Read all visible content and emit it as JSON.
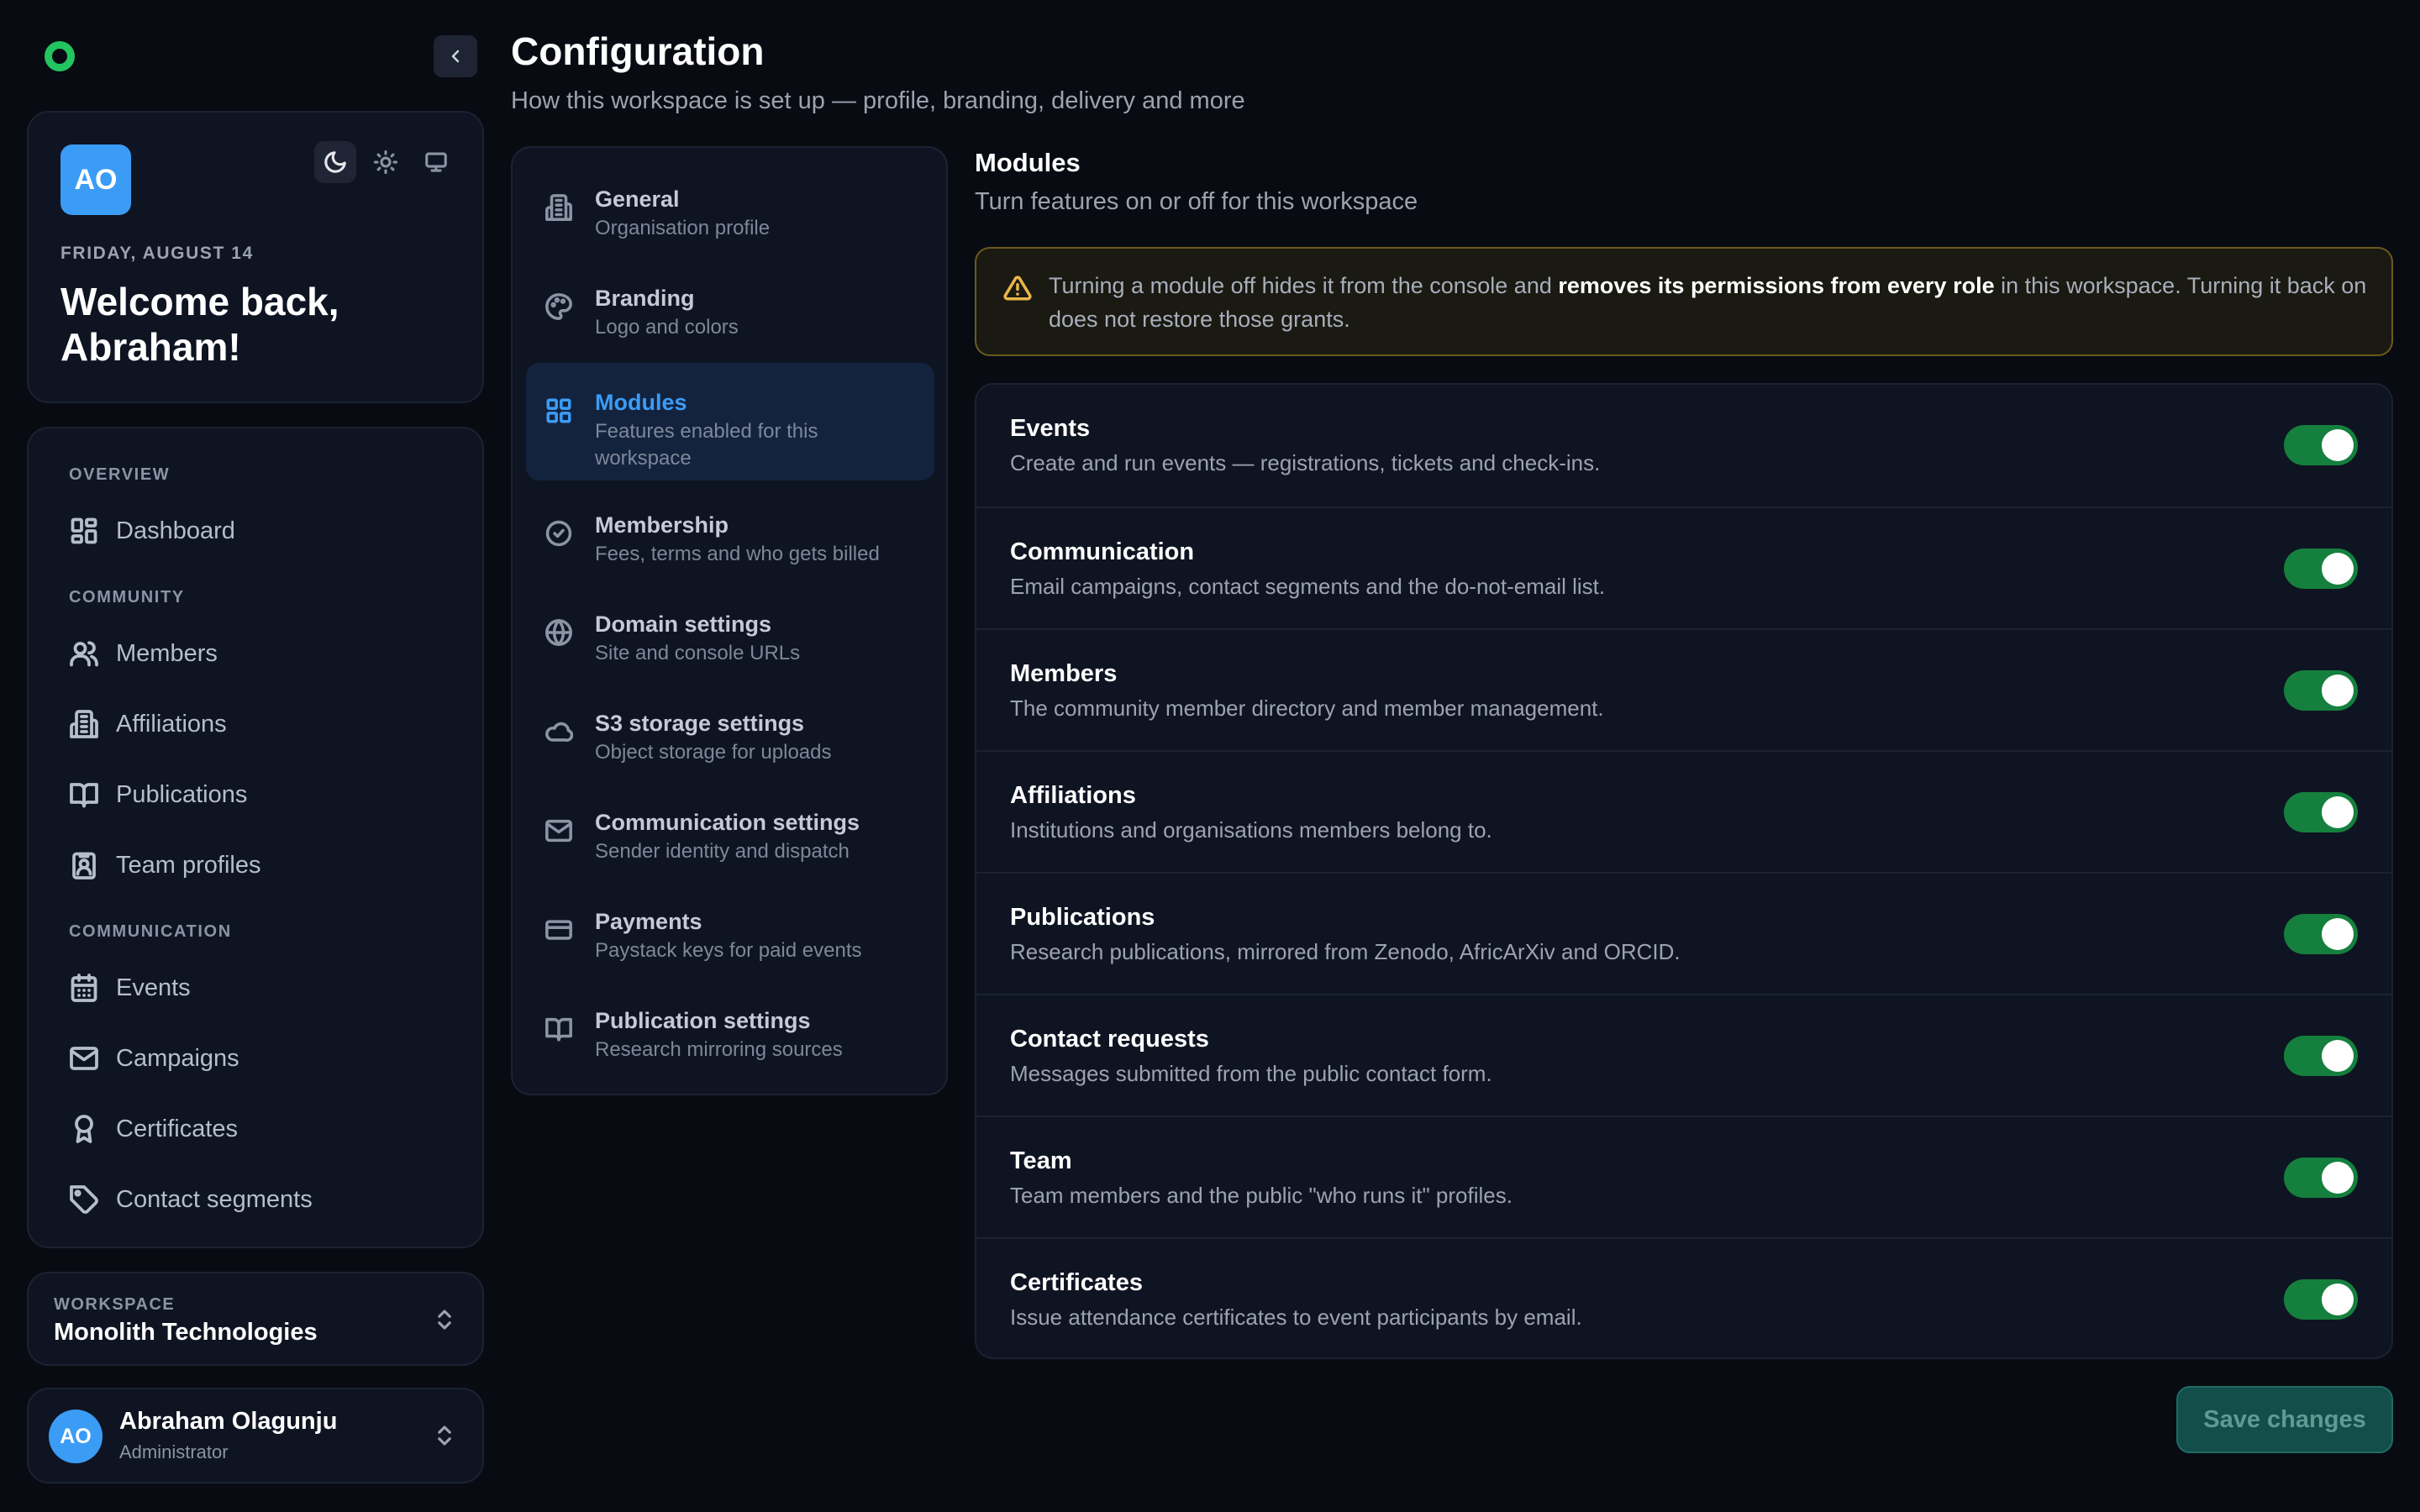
{
  "sidebar": {
    "profile": {
      "initials": "AO",
      "date": "FRIDAY, AUGUST 14",
      "welcome": "Welcome back, Abraham!",
      "theme_options": [
        "moon-icon",
        "sun-icon",
        "monitor-icon"
      ],
      "active_theme": "dark"
    },
    "nav": {
      "sections": [
        "OVERVIEW",
        "COMMUNITY",
        "COMMUNICATION"
      ],
      "items": [
        {
          "label": "Dashboard",
          "icon": "dashboard-icon",
          "section": "OVERVIEW"
        },
        {
          "label": "Members",
          "icon": "users-icon",
          "section": "COMMUNITY"
        },
        {
          "label": "Affiliations",
          "icon": "building-icon",
          "section": "COMMUNITY"
        },
        {
          "label": "Publications",
          "icon": "book-icon",
          "section": "COMMUNITY"
        },
        {
          "label": "Team profiles",
          "icon": "id-badge-icon",
          "section": "COMMUNITY"
        },
        {
          "label": "Events",
          "icon": "calendar-icon",
          "section": "COMMUNICATION"
        },
        {
          "label": "Campaigns",
          "icon": "mail-icon",
          "section": "COMMUNICATION"
        },
        {
          "label": "Certificates",
          "icon": "award-icon",
          "section": "COMMUNICATION"
        },
        {
          "label": "Contact segments",
          "icon": "tag-icon",
          "section": "COMMUNICATION"
        }
      ]
    },
    "workspace": {
      "label": "WORKSPACE",
      "name": "Monolith Technologies"
    },
    "user": {
      "initials": "AO",
      "name": "Abraham Olagunju",
      "role": "Administrator"
    }
  },
  "header": {
    "title": "Configuration",
    "subtitle": "How this workspace is set up — profile, branding, delivery and more"
  },
  "settings_menu": [
    {
      "title": "General",
      "desc": "Organisation profile",
      "icon": "building-icon"
    },
    {
      "title": "Branding",
      "desc": "Logo and colors",
      "icon": "palette-icon"
    },
    {
      "title": "Modules",
      "desc": "Features enabled for this workspace",
      "icon": "grid-icon",
      "active": true
    },
    {
      "title": "Membership",
      "desc": "Fees, terms and who gets billed",
      "icon": "badge-check-icon"
    },
    {
      "title": "Domain settings",
      "desc": "Site and console URLs",
      "icon": "globe-icon"
    },
    {
      "title": "S3 storage settings",
      "desc": "Object storage for uploads",
      "icon": "cloud-icon"
    },
    {
      "title": "Communication settings",
      "desc": "Sender identity and dispatch",
      "icon": "mail-icon"
    },
    {
      "title": "Payments",
      "desc": "Paystack keys for paid events",
      "icon": "credit-card-icon"
    },
    {
      "title": "Publication settings",
      "desc": "Research mirroring sources",
      "icon": "book-icon"
    }
  ],
  "modules": {
    "title": "Modules",
    "subtitle": "Turn features on or off for this workspace",
    "warning": {
      "pre": "Turning a module off hides it from the console and ",
      "bold": "removes its permissions from every role",
      "post": " in this workspace. Turning it back on does not restore those grants."
    },
    "items": [
      {
        "name": "Events",
        "desc": "Create and run events — registrations, tickets and check-ins.",
        "enabled": true
      },
      {
        "name": "Communication",
        "desc": "Email campaigns, contact segments and the do-not-email list.",
        "enabled": true
      },
      {
        "name": "Members",
        "desc": "The community member directory and member management.",
        "enabled": true
      },
      {
        "name": "Affiliations",
        "desc": "Institutions and organisations members belong to.",
        "enabled": true
      },
      {
        "name": "Publications",
        "desc": "Research publications, mirrored from Zenodo, AfricArXiv and ORCID.",
        "enabled": true
      },
      {
        "name": "Contact requests",
        "desc": "Messages submitted from the public contact form.",
        "enabled": true
      },
      {
        "name": "Team",
        "desc": "Team members and the public \"who runs it\" profiles.",
        "enabled": true
      },
      {
        "name": "Certificates",
        "desc": "Issue attendance certificates to event participants by email.",
        "enabled": true
      }
    ],
    "save_label": "Save changes"
  },
  "colors": {
    "accent": "#3b9cf6",
    "toggle_on": "#15803d",
    "logo": "#22c55e",
    "warning": "#e8b64a",
    "background": "#080b12"
  }
}
